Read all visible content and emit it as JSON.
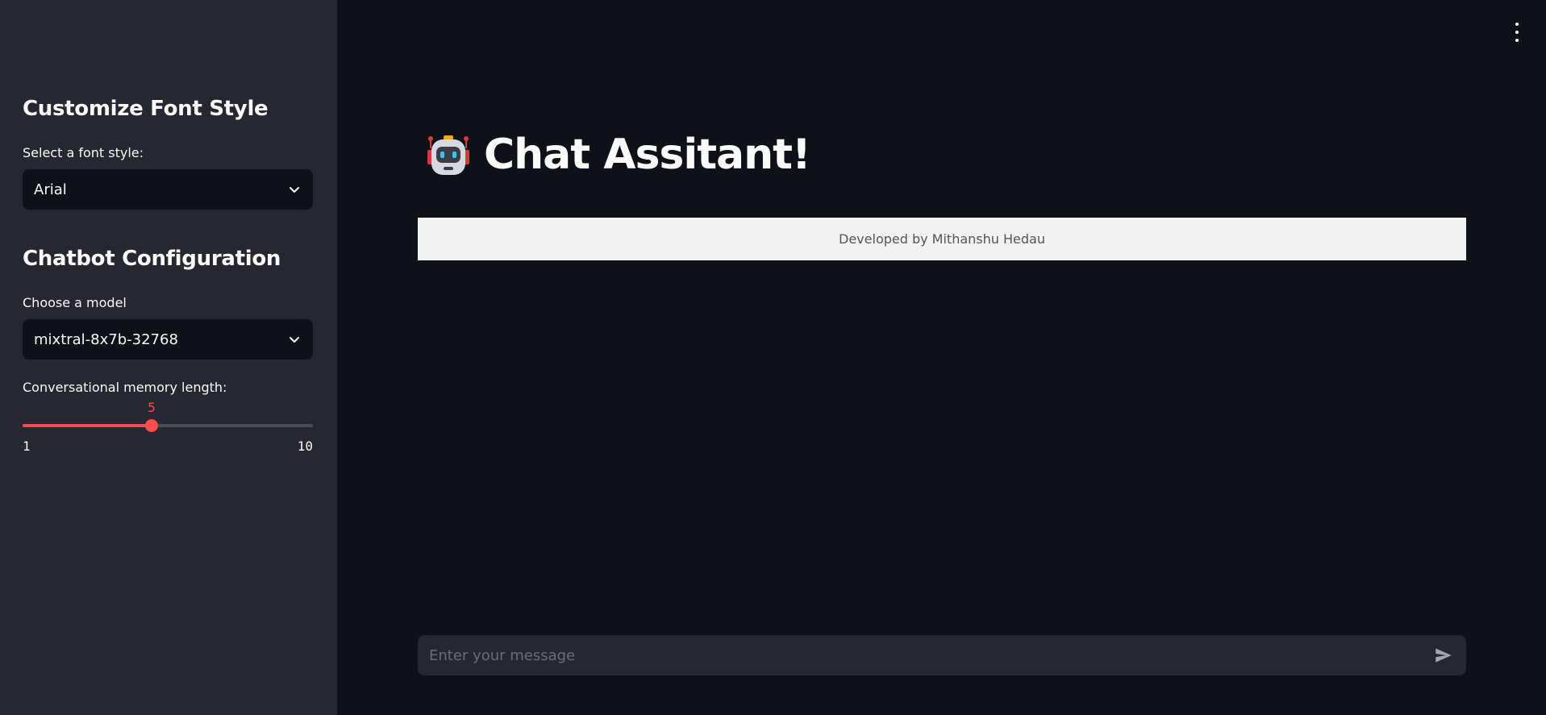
{
  "sidebar": {
    "font_section": {
      "heading": "Customize Font Style",
      "select_label": "Select a font style:",
      "selected": "Arial"
    },
    "chatbot_section": {
      "heading": "Chatbot Configuration",
      "model_label": "Choose a model",
      "model_selected": "mixtral-8x7b-32768",
      "memory_label": "Conversational memory length:",
      "memory": {
        "value": 5,
        "min": 1,
        "max": 10
      }
    }
  },
  "main": {
    "title": "Chat Assitant!",
    "title_icon": "robot-emoji",
    "banner": "Developed by Mithanshu Hedau",
    "chat_input": {
      "placeholder": "Enter your message"
    }
  },
  "icons": {
    "menu": "vertical-dots-icon",
    "dropdown": "chevron-down-icon",
    "send": "send-icon"
  },
  "colors": {
    "accent": "#ff4b4b",
    "sidebar_bg": "#262730",
    "main_bg": "#0e1117",
    "banner_bg": "#f2f2f2"
  }
}
